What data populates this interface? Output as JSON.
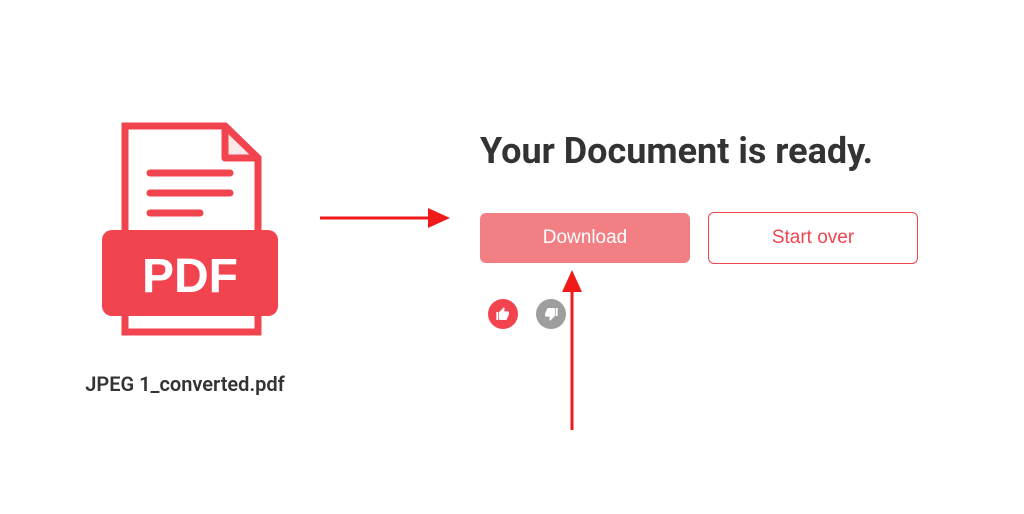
{
  "file": {
    "name": "JPEG 1_converted.pdf",
    "type_label": "PDF"
  },
  "heading": "Your Document is ready.",
  "buttons": {
    "download": "Download",
    "start_over": "Start over"
  },
  "feedback": {
    "thumbs_up": "thumbs-up",
    "thumbs_down": "thumbs-down"
  },
  "colors": {
    "accent": "#f2444f",
    "accent_light": "#f27f84",
    "gray": "#9e9e9e"
  }
}
